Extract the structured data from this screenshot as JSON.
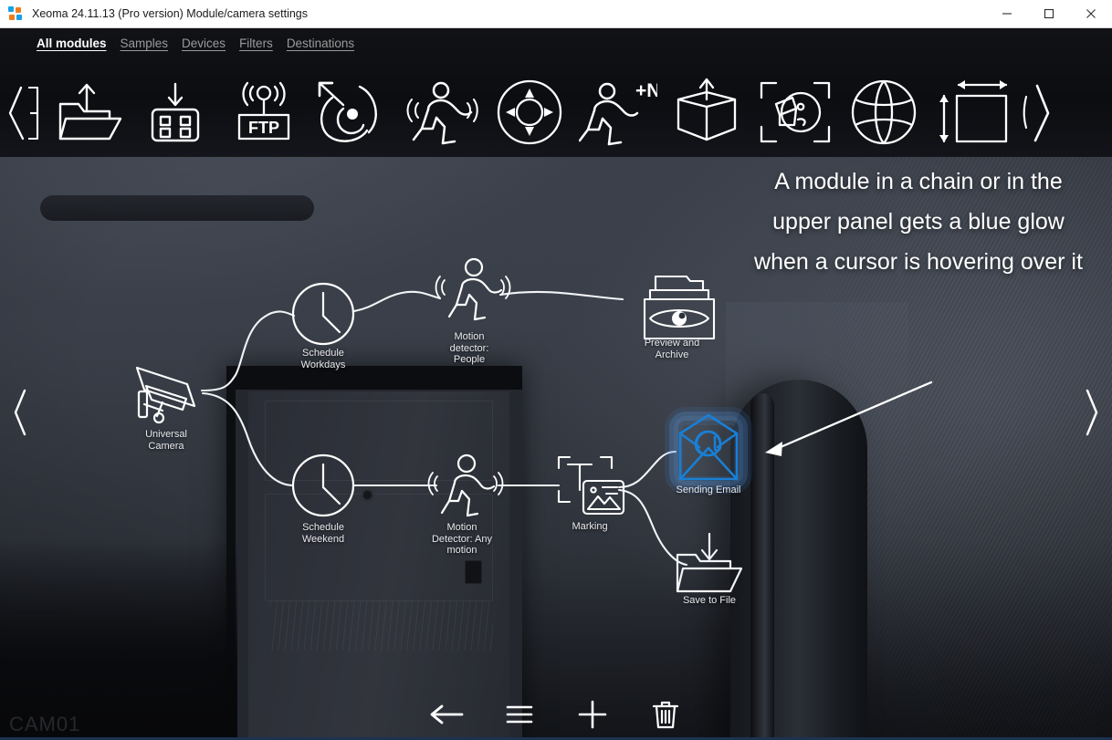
{
  "window": {
    "title": "Xeoma 24.11.13 (Pro version) Module/camera settings",
    "controls": {
      "minimize": "minimize-button",
      "maximize": "maximize-button",
      "close": "close-button"
    }
  },
  "top_panel": {
    "tabs": [
      {
        "label": "All modules",
        "active": true
      },
      {
        "label": "Samples",
        "active": false
      },
      {
        "label": "Devices",
        "active": false
      },
      {
        "label": "Filters",
        "active": false
      },
      {
        "label": "Destinations",
        "active": false
      }
    ],
    "scroll_left": "‹",
    "scroll_right": "›",
    "icons": [
      {
        "name": "folder-upload-icon",
        "title": "Upload folder"
      },
      {
        "name": "grid-download-icon",
        "title": "Grid download"
      },
      {
        "name": "ftp-upload-icon",
        "title": "FTP",
        "text": "FTP"
      },
      {
        "name": "radar-motion-icon",
        "title": "Radar motion"
      },
      {
        "name": "running-person-motion-icon",
        "title": "Motion detector"
      },
      {
        "name": "ptz-dpad-icon",
        "title": "PTZ control"
      },
      {
        "name": "people-counter-icon",
        "title": "People counter",
        "text": "+N"
      },
      {
        "name": "open-box-object-icon",
        "title": "Object detector"
      },
      {
        "name": "animal-detector-icon",
        "title": "Animal detector"
      },
      {
        "name": "ball-detector-icon",
        "title": "Ball detector"
      },
      {
        "name": "object-size-icon",
        "title": "Object size"
      }
    ]
  },
  "video": {
    "camera_watermark": "CAM01"
  },
  "chain": {
    "nodes": [
      {
        "id": "camera",
        "label": "Universal\nCamera",
        "icon": "cctv-camera-icon",
        "highlighted": false
      },
      {
        "id": "sched-wd",
        "label": "Schedule\nWorkdays",
        "icon": "clock-icon",
        "highlighted": false
      },
      {
        "id": "motion-p",
        "label": "Motion\ndetector:\nPeople",
        "icon": "running-person-icon",
        "highlighted": false
      },
      {
        "id": "preview",
        "label": "Preview and\nArchive",
        "icon": "archive-eye-icon",
        "highlighted": false
      },
      {
        "id": "sched-we",
        "label": "Schedule\nWeekend",
        "icon": "clock-icon",
        "highlighted": false
      },
      {
        "id": "motion-a",
        "label": "Motion\nDetector: Any\nmotion",
        "icon": "running-person-icon",
        "highlighted": false
      },
      {
        "id": "marking",
        "label": "Marking",
        "icon": "marking-text-image-icon",
        "highlighted": false
      },
      {
        "id": "email",
        "label": "Sending Email",
        "icon": "email-envelope-icon",
        "highlighted": true
      },
      {
        "id": "savefile",
        "label": "Save to File",
        "icon": "folder-download-icon",
        "highlighted": false
      }
    ]
  },
  "annotation": {
    "text": "A module in a chain or in the upper panel gets a blue glow when a cursor is hovering over it",
    "pointer": "arrow pointing to Sending Email module"
  },
  "bottom_bar": {
    "buttons": [
      {
        "name": "back-button",
        "icon": "left-arrow-icon"
      },
      {
        "name": "menu-button",
        "icon": "hamburger-menu-icon"
      },
      {
        "name": "add-button",
        "icon": "plus-icon"
      },
      {
        "name": "delete-button",
        "icon": "trash-icon"
      }
    ]
  },
  "colors": {
    "glow_blue": "#1a7fd4",
    "accent_blue": "#18a0e8",
    "accent_orange": "#f07d1a",
    "panel_bg": "#0c0d11",
    "video_bg": "#3a3f49",
    "text_white": "#ffffff",
    "tab_inactive": "#9a9a9a"
  }
}
